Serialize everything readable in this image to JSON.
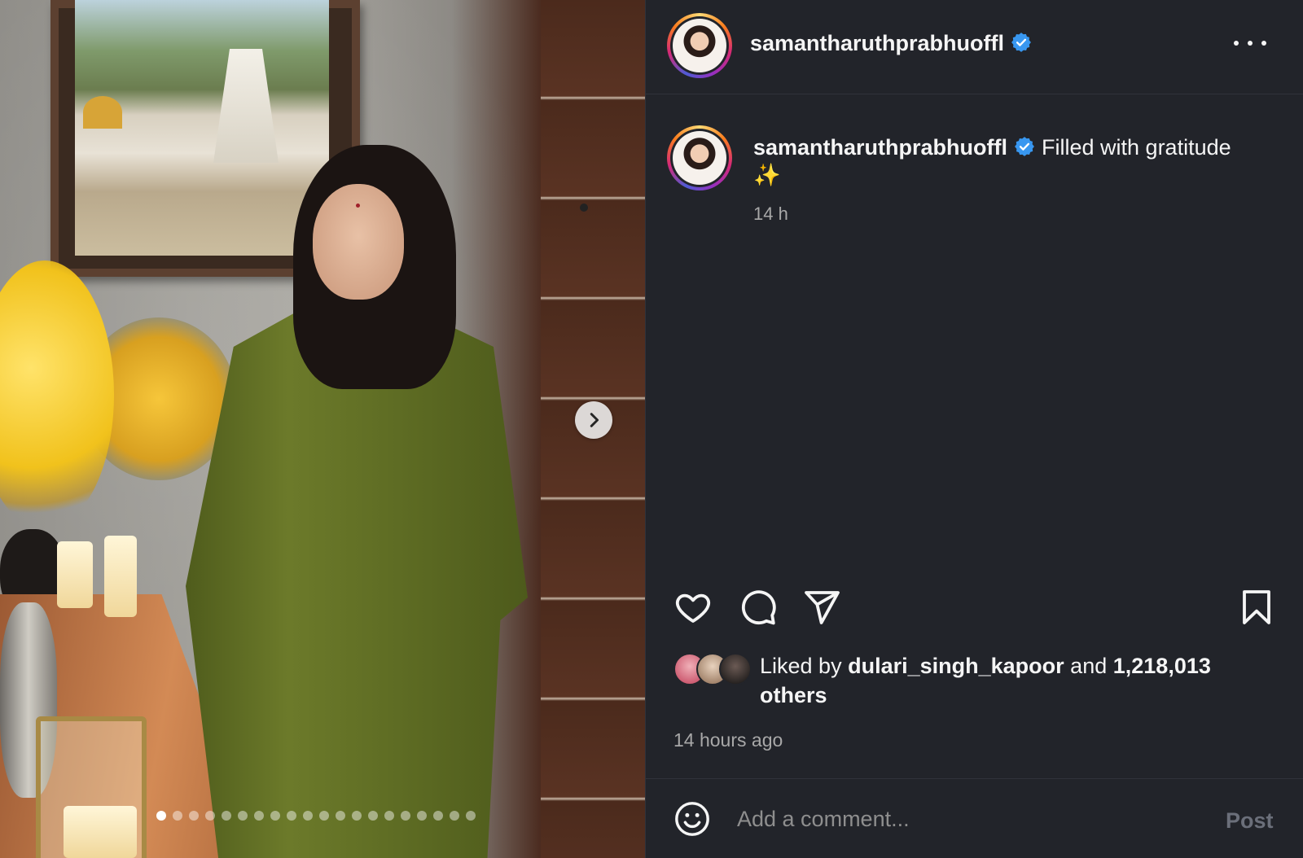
{
  "media": {
    "slide_count": 20,
    "active_slide": 1,
    "next_icon": "chevron-right-icon"
  },
  "header": {
    "username": "samantharuthprabhuoffl",
    "verified_icon": "verified-badge-icon",
    "more_icon": "more-horizontal-icon"
  },
  "caption": {
    "username": "samantharuthprabhuoffl",
    "text": "Filled with gratitude",
    "emoji": "✨",
    "time": "14 h"
  },
  "actions": {
    "icons": [
      "heart-icon",
      "comment-icon",
      "share-icon",
      "bookmark-icon"
    ]
  },
  "likes": {
    "prefix": "Liked by",
    "liked_user": "dulari_singh_kapoor",
    "connector": "and",
    "count": "1,218,013",
    "suffix": "others"
  },
  "time_ago": "14 hours ago",
  "comment": {
    "placeholder": "Add a comment...",
    "post_label": "Post",
    "emoji_icon": "emoji-smile-icon"
  },
  "colors": {
    "background": "#22242a",
    "verified": "#3897f0",
    "secondary_text": "#a8a8a8"
  }
}
